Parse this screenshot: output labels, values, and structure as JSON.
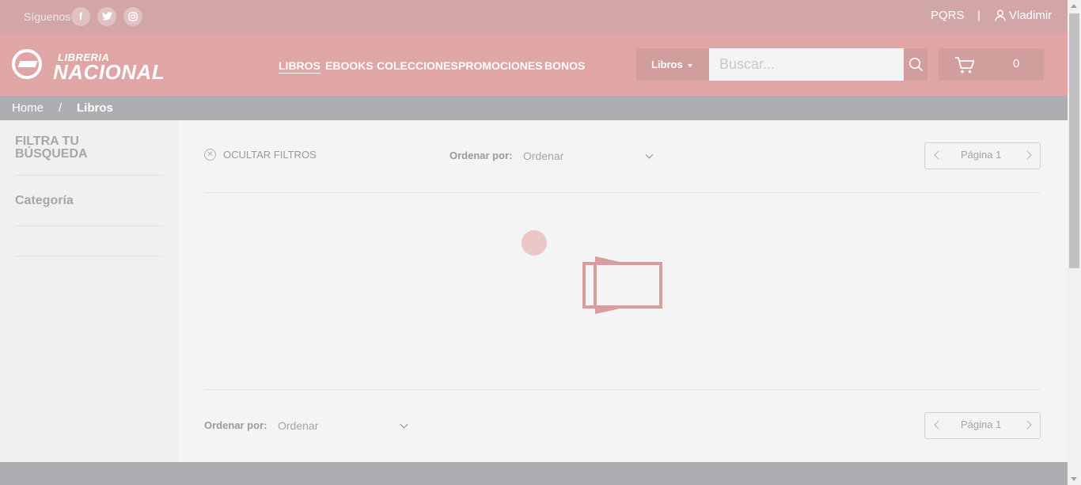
{
  "topbar": {
    "follow_label": "Síguenos",
    "social": [
      {
        "name": "facebook-icon",
        "glyph": "f"
      },
      {
        "name": "twitter-icon",
        "glyph": "t"
      },
      {
        "name": "instagram-icon",
        "glyph": "◎"
      }
    ],
    "pqrs": "PQRS",
    "separator": "|",
    "user": "Vladimir"
  },
  "header": {
    "logo_line1": "LIBRERIA",
    "logo_line2": "NACIONAL",
    "nav": [
      "LIBROS",
      "EBOOKS",
      "COLECCIONES",
      "PROMOCIONES",
      "BONOS"
    ],
    "search_category": "Libros",
    "search_placeholder": "Buscar...",
    "cart_count": "0"
  },
  "breadcrumb": {
    "home": "Home",
    "separator": "/",
    "current": "Libros"
  },
  "sidebar": {
    "title": "FILTRA TU BÚSQUEDA",
    "category": "Categoría"
  },
  "content": {
    "hide_filters": "OCULTAR FILTROS",
    "sort_label": "Ordenar por:",
    "sort_value": "Ordenar",
    "page_label": "Página 1"
  },
  "colors": {
    "topbar": "#d2a6a6",
    "header": "#e0a5a5",
    "breadcrumb": "#aeaeb2",
    "loader": "#d89d9d"
  }
}
